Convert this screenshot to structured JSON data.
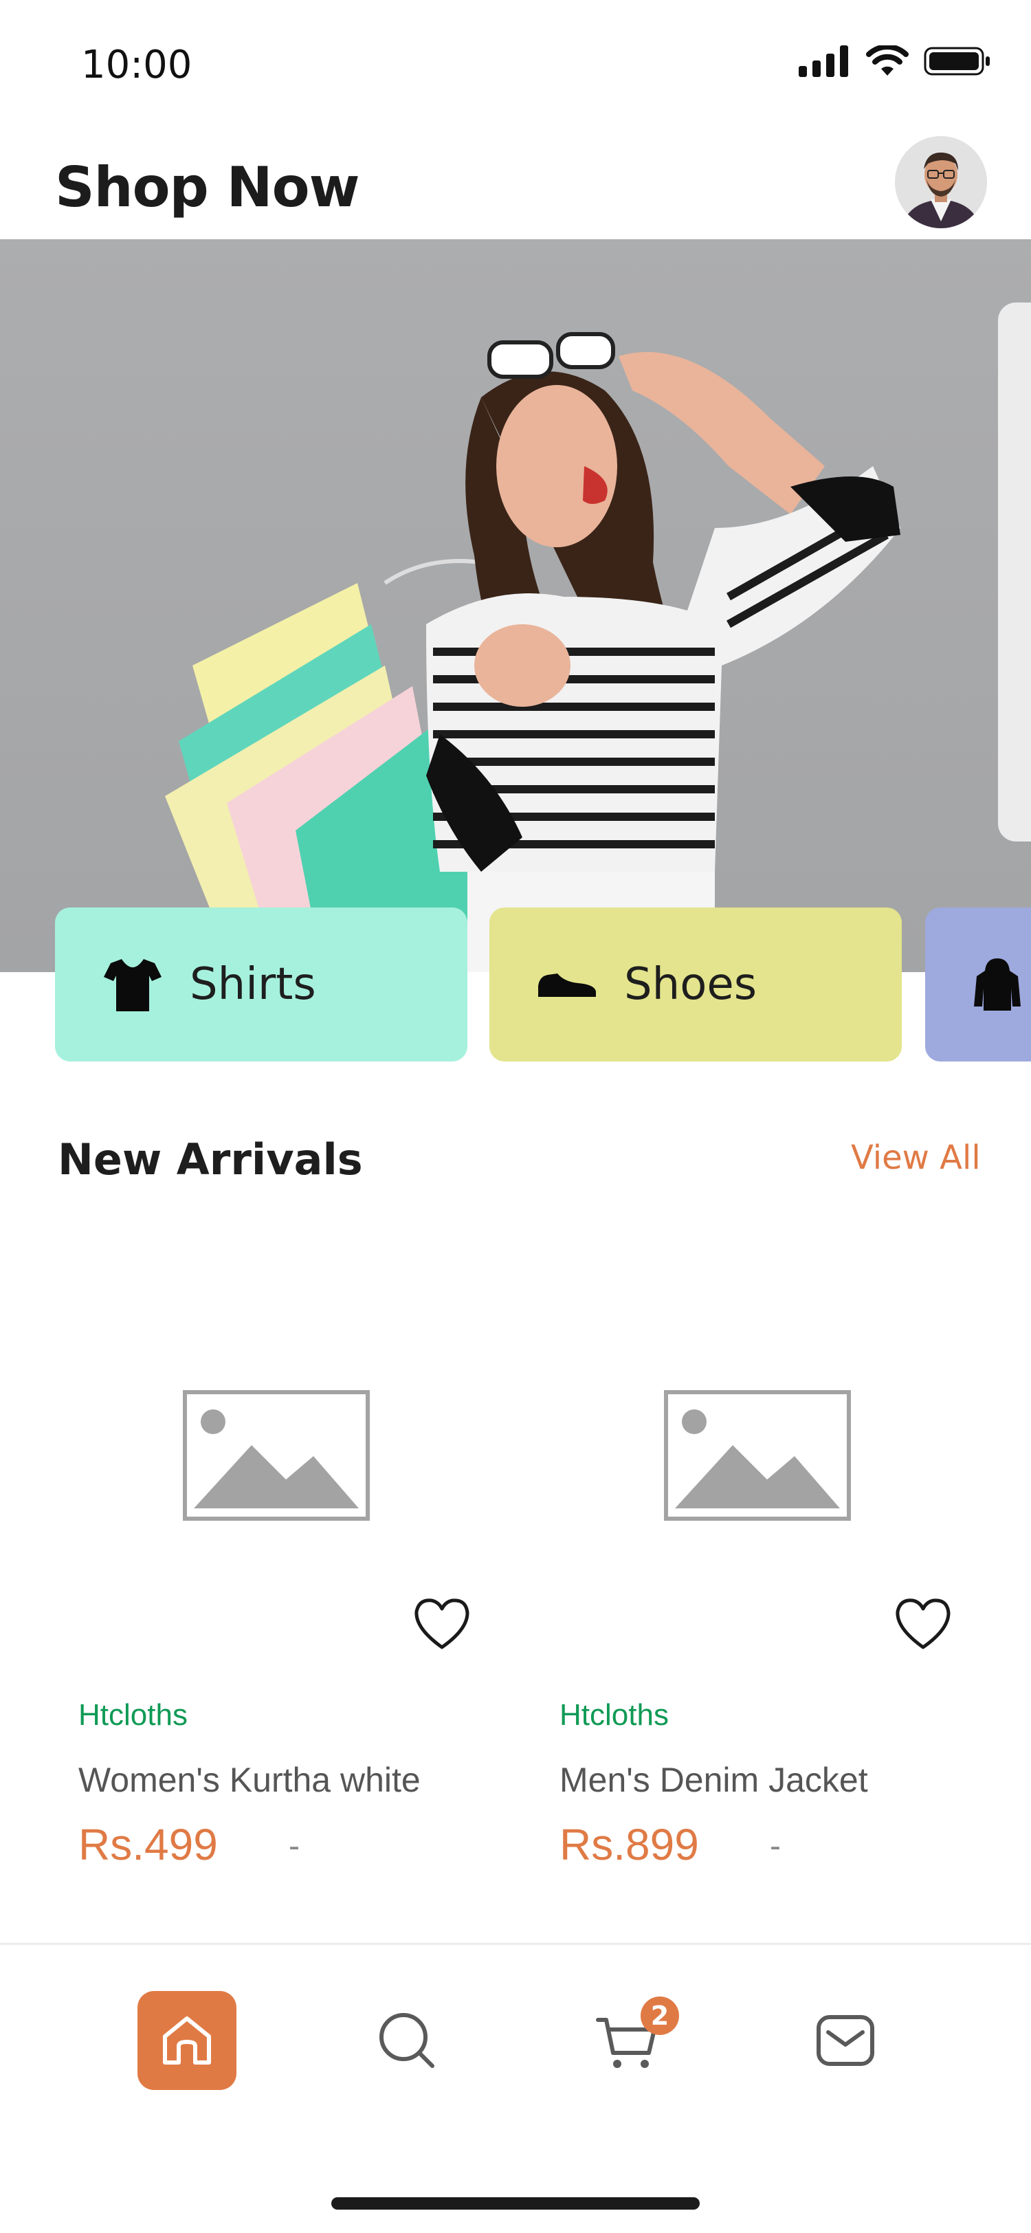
{
  "status_bar": {
    "time": "10:00"
  },
  "header": {
    "title": "Shop Now"
  },
  "categories": [
    {
      "label": "Shirts",
      "color": "#a6f1dd",
      "icon": "tshirt-icon"
    },
    {
      "label": "Shoes",
      "color": "#e3e48d",
      "icon": "shoe-icon"
    },
    {
      "label": "",
      "color": "#9ea9de",
      "icon": "hoodie-icon"
    }
  ],
  "new_arrivals": {
    "title": "New Arrivals",
    "view_all": "View All",
    "products": [
      {
        "brand": "Htcloths",
        "name": "Women's Kurtha white",
        "price": "Rs.499",
        "separator": "-"
      },
      {
        "brand": "Htcloths",
        "name": "Men's Denim Jacket",
        "price": "Rs.899",
        "separator": "-"
      }
    ]
  },
  "bottom_nav": {
    "active": "home",
    "cart_count": "2"
  },
  "colors": {
    "accent": "#e07a45",
    "brand_green": "#0f9a55"
  }
}
